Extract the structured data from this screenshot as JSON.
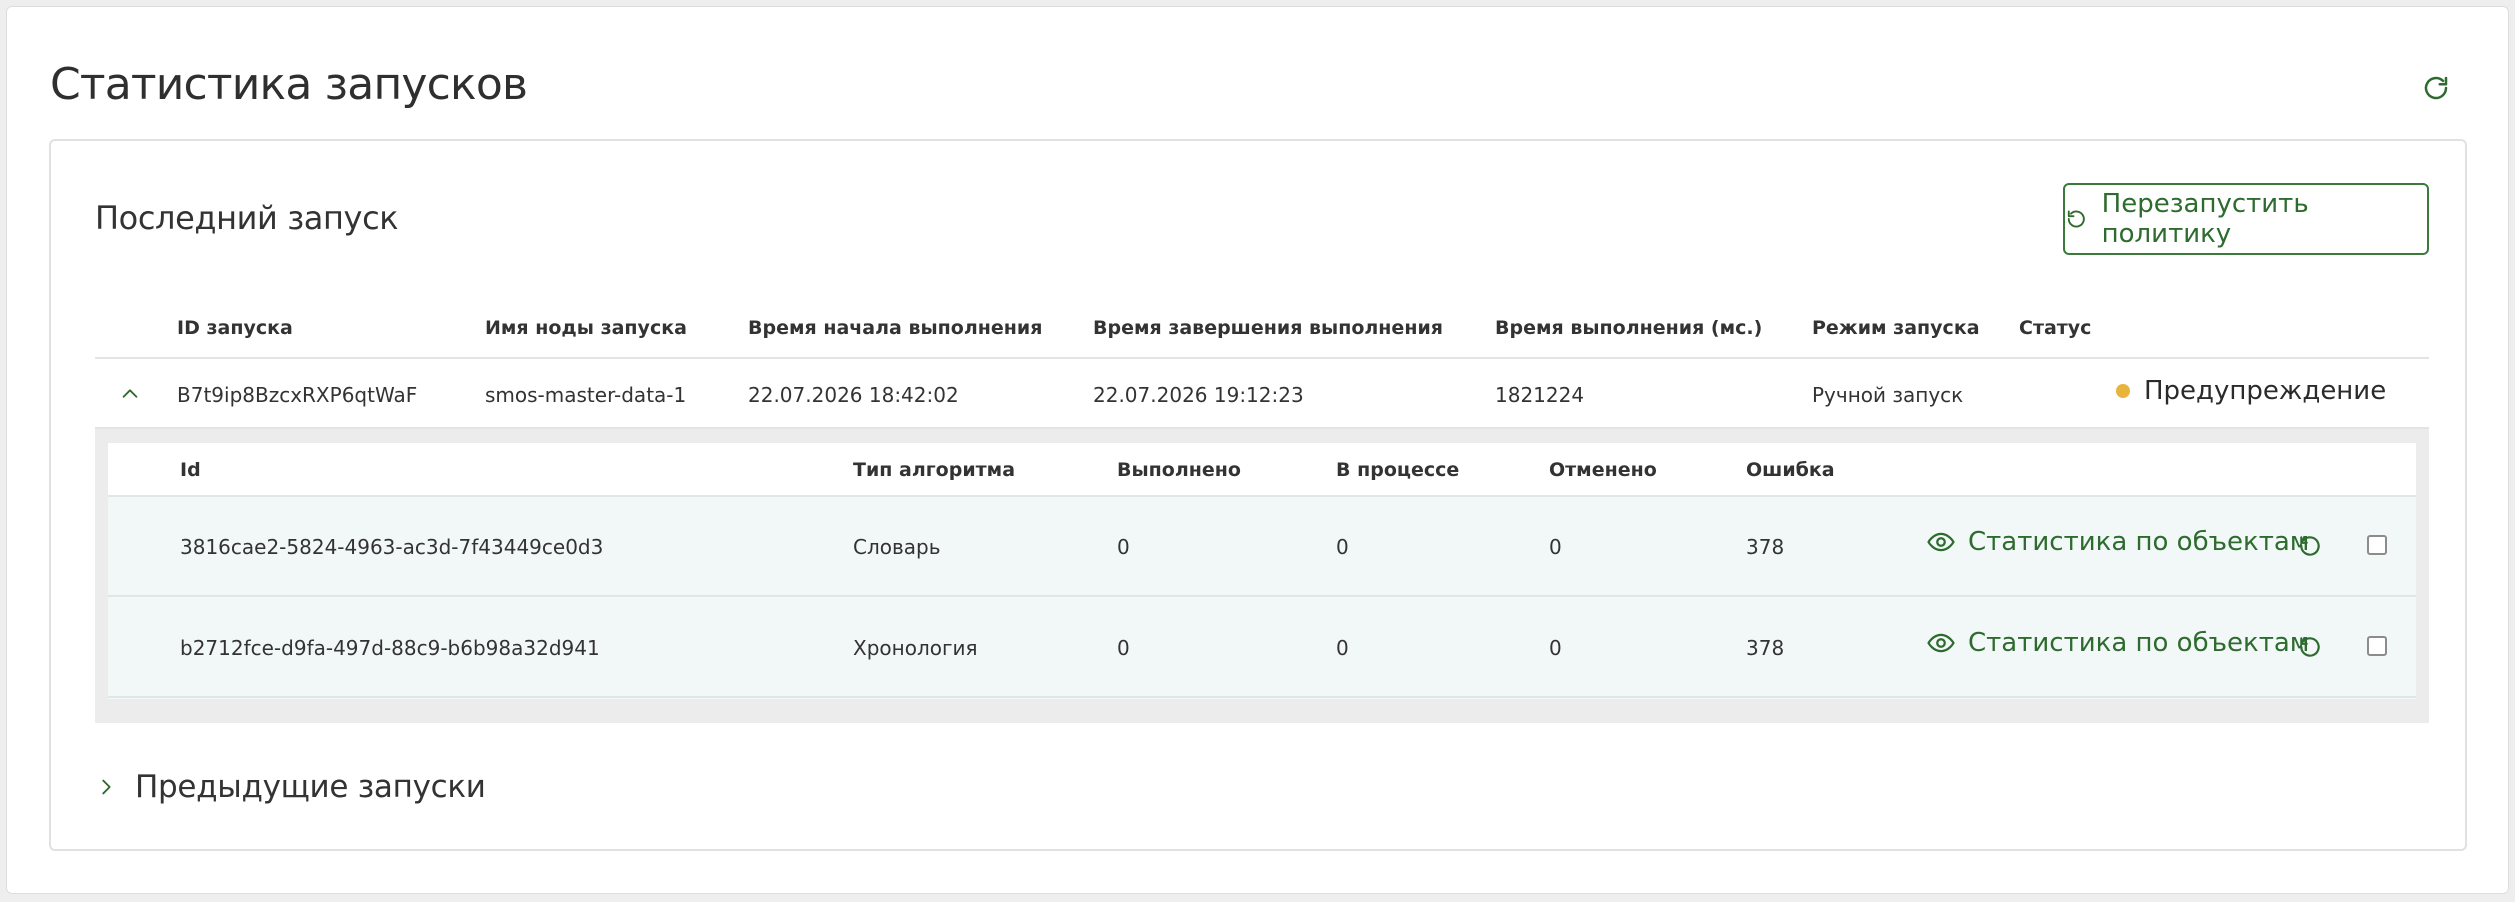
{
  "header": {
    "title": "Статистика запусков"
  },
  "last_run": {
    "title": "Последний запуск",
    "restart_button": "Перезапустить политику",
    "columns": [
      "ID запуска",
      "Имя ноды запуска",
      "Время начала выполнения",
      "Время завершения выполнения",
      "Время выполнения (мс.)",
      "Режим запуска",
      "Статус"
    ],
    "row": {
      "id": "B7t9ip8BzcxRXP6qtWaF",
      "node": "smos-master-data-1",
      "start": "22.07.2026 18:42:02",
      "end": "22.07.2026 19:12:23",
      "duration": "1821224",
      "mode": "Ручной запуск",
      "status": "Предупреждение",
      "status_color": "#e8b43b"
    }
  },
  "details": {
    "columns": [
      "Id",
      "Тип алгоритма",
      "Выполнено",
      "В процессе",
      "Отменено",
      "Ошибка"
    ],
    "stats_link": "Статистика по объектам",
    "rows": [
      {
        "id": "3816cae2-5824-4963-ac3d-7f43449ce0d3",
        "type": "Словарь",
        "done": "0",
        "in_progress": "0",
        "cancelled": "0",
        "error": "378"
      },
      {
        "id": "b2712fce-d9fa-497d-88c9-b6b98a32d941",
        "type": "Хронология",
        "done": "0",
        "in_progress": "0",
        "cancelled": "0",
        "error": "378"
      }
    ]
  },
  "previous_runs": {
    "label": "Предыдущие запуски"
  },
  "colors": {
    "accent": "#2e6b2e",
    "warning": "#e8b43b"
  },
  "icons": [
    "refresh-icon",
    "restart-icon",
    "chevron-up-icon",
    "eye-icon",
    "chevron-right-icon"
  ]
}
